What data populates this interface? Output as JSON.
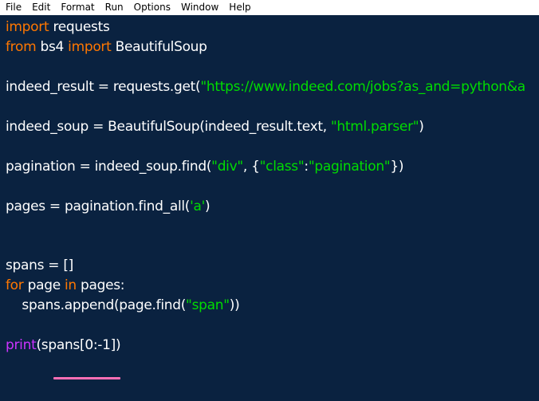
{
  "menu": {
    "file": "File",
    "edit": "Edit",
    "format": "Format",
    "run": "Run",
    "options": "Options",
    "window": "Window",
    "help": "Help"
  },
  "code": {
    "l1": {
      "kw": "import",
      "rest": " requests"
    },
    "l2": {
      "kw1": "from",
      "mid": " bs4 ",
      "kw2": "import",
      "rest": " BeautifulSoup"
    },
    "l4": {
      "pre": "indeed_result = requests.get(",
      "str": "\"https://www.indeed.com/jobs?as_and=python&a"
    },
    "l6": {
      "pre": "indeed_soup = BeautifulSoup(indeed_result.text, ",
      "str": "\"html.parser\"",
      "post": ")"
    },
    "l8": {
      "pre": "pagination = indeed_soup.find(",
      "str1": "\"div\"",
      "mid1": ", {",
      "str2": "\"class\"",
      "mid2": ":",
      "str3": "\"pagination\"",
      "post": "})"
    },
    "l10": {
      "pre": "pages = pagination.find_all(",
      "str": "'a'",
      "post": ")"
    },
    "l13": {
      "txt": "spans = []"
    },
    "l14": {
      "kw1": "for",
      "mid": " page ",
      "kw2": "in",
      "rest": " pages:"
    },
    "l15": {
      "pre": "    spans.append(page.find(",
      "str": "\"span\"",
      "post": "))"
    },
    "l17": {
      "bi": "print",
      "rest": "(spans[0:-1])"
    }
  },
  "colors": {
    "background": "#0a2240",
    "keyword": "#ff7700",
    "string": "#00dd00",
    "builtin": "#cc33ff",
    "annotation_underline": "#ff6fb5"
  }
}
